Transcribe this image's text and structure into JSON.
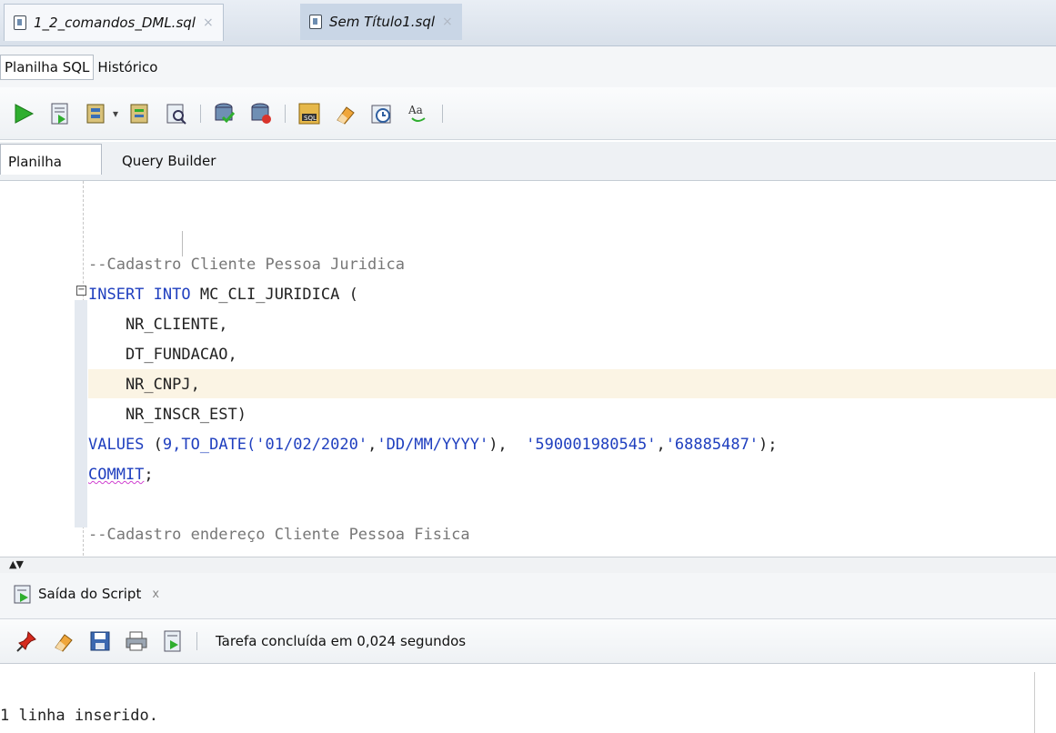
{
  "editor_tabs": [
    {
      "label": "1_2_comandos_DML.sql",
      "close": "×"
    },
    {
      "label": "Sem Título1.sql",
      "close": "×"
    }
  ],
  "sub_tabs": {
    "sql_sheet": "Planilha SQL",
    "history": "Histórico"
  },
  "toolbar_icons": [
    "run-statement-icon",
    "run-script-icon",
    "autotrace-icon",
    "explain-plan-icon",
    "sql-tuning-icon",
    "commit-icon",
    "rollback-icon",
    "unshared-sql-icon",
    "clear-icon",
    "sql-history-icon",
    "format-case-icon"
  ],
  "worksheet_tabs": {
    "worksheet": "Planilha",
    "query_builder": "Query Builder"
  },
  "code": {
    "line1": "--Cadastro Cliente Pessoa Juridica",
    "line2_kw": "INSERT INTO",
    "line2_rest": " MC_CLI_JURIDICA (",
    "line3": "    NR_CLIENTE,",
    "line4": "    DT_FUNDACAO,",
    "line5": "    NR_CNPJ,",
    "line6": "    NR_INSCR_EST)",
    "line7_kw": "VALUES",
    "line7_a": " (",
    "line7_num": "9",
    "line7_b": ",TO_DATE(",
    "line7_str1": "'01/02/2020'",
    "line7_c": ",",
    "line7_str2": "'DD/MM/YYYY'",
    "line7_d": "),  ",
    "line7_str3": "'590001980545'",
    "line7_e": ",",
    "line7_str4": "'68885487'",
    "line7_f": ");",
    "line8_kw": "COMMIT",
    "line8_rest": ";",
    "line9": "--Cadastro endereço Cliente Pessoa Fisica"
  },
  "output": {
    "tab_label": "Saída do Script",
    "tab_close": "x",
    "status": "Tarefa concluída em 0,024 segundos",
    "result": "1 linha inserido."
  },
  "colors": {
    "keyword": "#1f3fbf",
    "comment": "#777777",
    "current_line": "#fbf4e4"
  }
}
